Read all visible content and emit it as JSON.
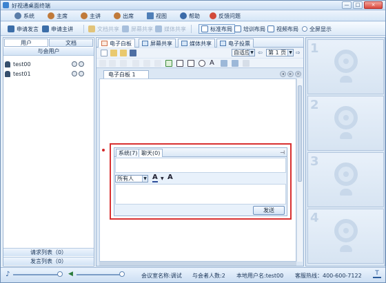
{
  "window": {
    "title": "好视通桌面终端",
    "min_glyph": "—",
    "max_glyph": "□",
    "close_glyph": "×"
  },
  "menu": [
    "系统",
    "主席",
    "主讲",
    "出席",
    "视图",
    "帮助",
    "反馈问题"
  ],
  "toolbar": {
    "items": [
      "申请发言",
      "申请主讲",
      "文档共享",
      "屏幕共享",
      "媒体共享",
      "标准布局",
      "培训布局",
      "视频布局",
      "全屏显示"
    ]
  },
  "left_panel": {
    "tabs": [
      "用户",
      "文档"
    ],
    "header": "与会用户",
    "users": [
      "test00",
      "test01"
    ],
    "request_list": "请求列表（0）",
    "speak_list": "发言列表（0）"
  },
  "center": {
    "tabs": [
      "电子白板",
      "屏幕共享",
      "媒体共享",
      "电子投票"
    ],
    "zoom": "自适应",
    "page": "第 1 页",
    "doc_tab": "电子白板 1"
  },
  "chat": {
    "tabs": [
      "系统(7)",
      "聊天(0)"
    ],
    "pin_glyph": "⊣",
    "recipient": "所有人",
    "font_glyph": "A",
    "send_label": "发送"
  },
  "video_slots": [
    "1",
    "2",
    "3",
    "4"
  ],
  "status": {
    "room_name": "会议室名称:调试",
    "participants": "与会者人数:2",
    "local_user": "本地用户名:test00",
    "hotline": "客服热线：400-600-7122"
  },
  "colors": {
    "accent": "#d82f2f",
    "brand": "#3c83d0"
  }
}
